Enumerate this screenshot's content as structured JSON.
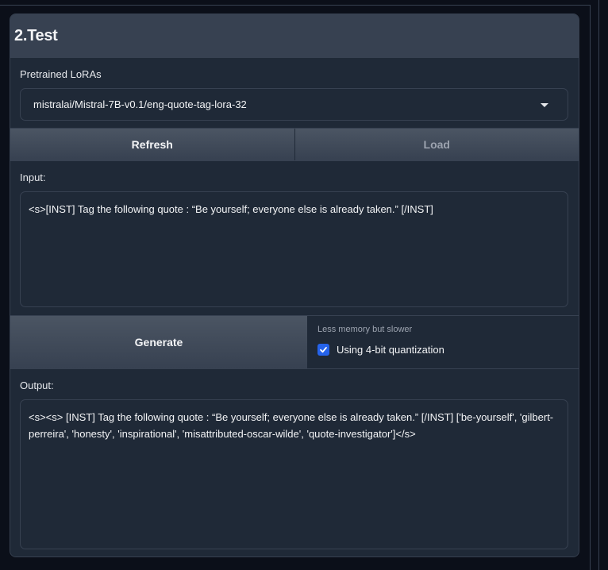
{
  "panel": {
    "title": "2.Test"
  },
  "lora": {
    "label": "Pretrained LoRAs",
    "selected": "mistralai/Mistral-7B-v0.1/eng-quote-tag-lora-32"
  },
  "buttons": {
    "refresh": "Refresh",
    "load": "Load",
    "generate": "Generate"
  },
  "input": {
    "label": "Input:",
    "value": "<s>[INST] Tag the following quote : “Be yourself; everyone else is already taken.” [/INST]"
  },
  "quantization": {
    "info": "Less memory but slower",
    "label": "Using 4-bit quantization",
    "checked": true
  },
  "output": {
    "label": "Output:",
    "value": "<s><s> [INST] Tag the following quote : “Be yourself; everyone else is already taken.” [/INST] ['be-yourself', 'gilbert-perreira', 'honesty', 'inspirational', 'misattributed-oscar-wilde', 'quote-investigator']</s>"
  },
  "colors": {
    "background": "#0b0f19",
    "panel": "#1f2937",
    "border": "#374151",
    "accent": "#2563eb"
  }
}
